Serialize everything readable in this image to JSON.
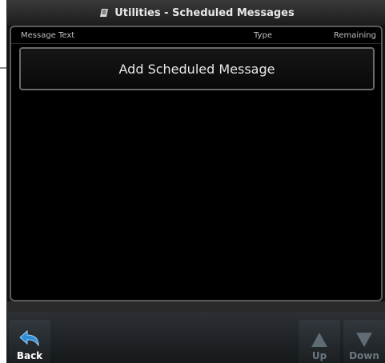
{
  "title": {
    "icon": "utilities-icon",
    "text": "Utilities - Scheduled Messages"
  },
  "columns": {
    "message_text": "Message Text",
    "type": "Type",
    "remaining": "Remaining"
  },
  "add_button": {
    "label": "Add Scheduled Message"
  },
  "toolbar": {
    "back_label": "Back",
    "up_label": "Up",
    "down_label": "Down"
  },
  "colors": {
    "background": "#000000",
    "frame": "#121212",
    "button_border": "#6a6a6a",
    "text": "#e6e6e6",
    "back_arrow": "#2f8fd6",
    "disabled": "#6c7880"
  }
}
